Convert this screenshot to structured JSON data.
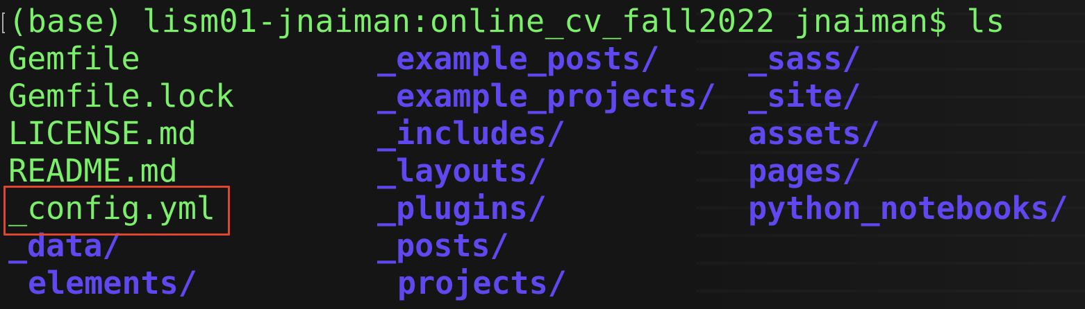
{
  "terminal": {
    "prompt_line": "(base) lism01-jnaiman:online_cv_fall2022 jnaiman$ ls",
    "rows": [
      {
        "c1": {
          "text": "Gemfile",
          "type": "file"
        },
        "c2": {
          "text": "_example_posts/",
          "type": "dir"
        },
        "c3": {
          "text": "_sass/",
          "type": "dir"
        }
      },
      {
        "c1": {
          "text": "Gemfile.lock",
          "type": "file"
        },
        "c2": {
          "text": "_example_projects/",
          "type": "dir"
        },
        "c3": {
          "text": "_site/",
          "type": "dir"
        }
      },
      {
        "c1": {
          "text": "LICENSE.md",
          "type": "file"
        },
        "c2": {
          "text": "_includes/",
          "type": "dir"
        },
        "c3": {
          "text": "assets/",
          "type": "dir"
        }
      },
      {
        "c1": {
          "text": "README.md",
          "type": "file"
        },
        "c2": {
          "text": "_layouts/",
          "type": "dir"
        },
        "c3": {
          "text": "pages/",
          "type": "dir"
        }
      },
      {
        "c1": {
          "text": "_config.yml",
          "type": "file"
        },
        "c2": {
          "text": "_plugins/",
          "type": "dir"
        },
        "c3": {
          "text": "python_notebooks/",
          "type": "dir"
        }
      },
      {
        "c1": {
          "text": "_data/",
          "type": "dir"
        },
        "c2": {
          "text": "_posts/",
          "type": "dir"
        },
        "c3": {
          "text": "",
          "type": "dir"
        }
      },
      {
        "c1": {
          "text": "elements/",
          "type": "dir"
        },
        "c2": {
          "text": "projects/",
          "type": "dir"
        },
        "c3": {
          "text": "",
          "type": "dir"
        }
      }
    ]
  },
  "colors": {
    "background": "#151515",
    "file_text": "#7cf06a",
    "dir_text": "#5f48f0",
    "highlight_box": "#e0462e"
  }
}
